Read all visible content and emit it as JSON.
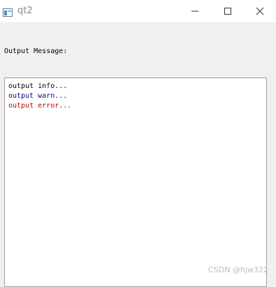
{
  "window": {
    "title": "qt2",
    "icon": "qt-window-icon"
  },
  "controls": {
    "minimize_icon": "minimize-icon",
    "maximize_icon": "maximize-icon",
    "close_icon": "close-icon"
  },
  "main": {
    "label": "Output Message:",
    "lines": [
      {
        "text": "output info...",
        "color": "#000000"
      },
      {
        "text": "output warn...",
        "color": "#000080"
      },
      {
        "text": "output error...",
        "color": "#c00000"
      }
    ]
  },
  "watermark": "CSDN @hjw322"
}
